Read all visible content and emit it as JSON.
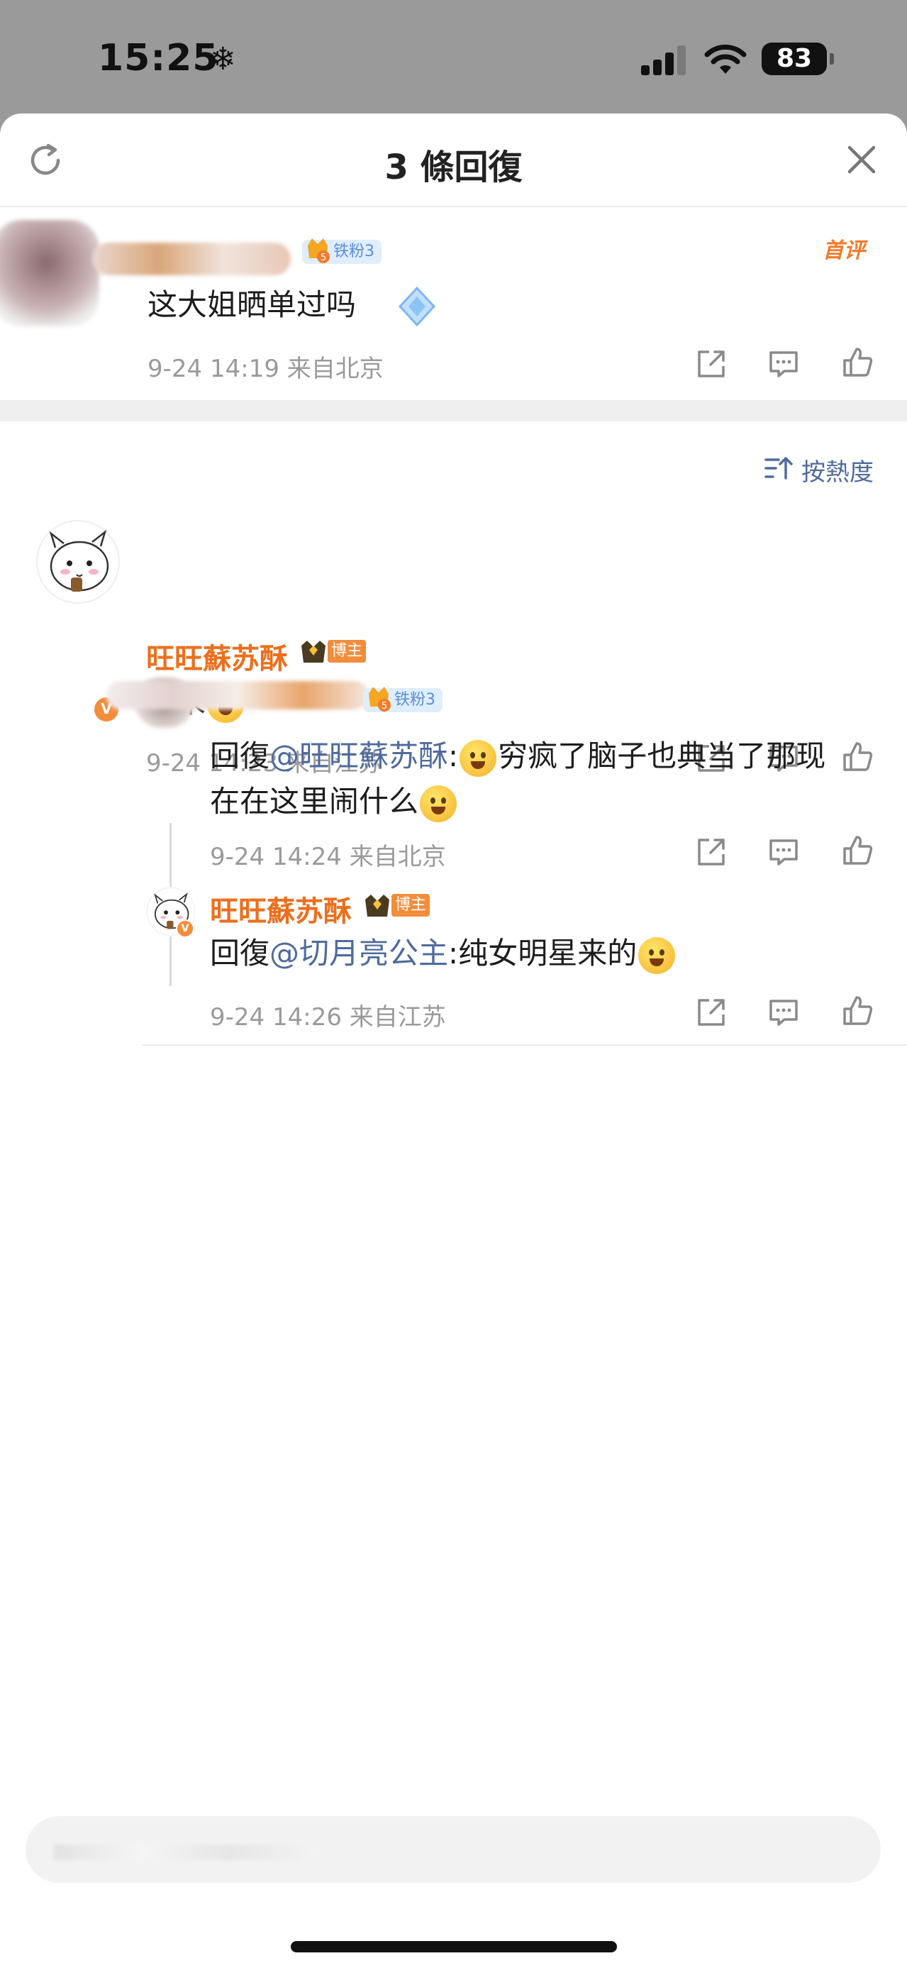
{
  "status_bar": {
    "time": "15:25",
    "battery": "83"
  },
  "header": {
    "title": "3 條回復"
  },
  "root_comment": {
    "first_tag": "首评",
    "fan_badge": "铁粉3",
    "fan_level": "5",
    "text": "这大姐晒单过吗",
    "meta": "9-24 14:19 来自北京"
  },
  "sort": {
    "label": "按熱度"
  },
  "comments": [
    {
      "username": "旺旺蘇苏酥",
      "badge": "博主",
      "verified": "V",
      "text": "从未",
      "meta": "9-24 14:23 来自江苏"
    }
  ],
  "replies": [
    {
      "fan_badge": "铁粉3",
      "fan_level": "5",
      "prefix": "回復",
      "mention": "@旺旺蘇苏酥",
      "text_line1": "穷疯了脑子也典当了那现",
      "text_line2": "在在这里闹什么",
      "meta": "9-24 14:24 来自北京"
    },
    {
      "username": "旺旺蘇苏酥",
      "badge": "博主",
      "verified": "V",
      "prefix": "回復",
      "mention": "@切月亮公主",
      "text": "纯女明星来的",
      "meta": "9-24 14:26 来自江苏"
    }
  ],
  "colors": {
    "accent_orange": "#ec6f1d",
    "mention_blue": "#4f6b9d",
    "meta_gray": "#9a9a9a"
  },
  "icons": [
    "snowflake-icon",
    "signal-icon",
    "wifi-icon",
    "battery-icon",
    "refresh-icon",
    "close-icon",
    "share-icon",
    "comment-icon",
    "like-icon",
    "sort-icon",
    "crown-icon",
    "verified-icon"
  ]
}
